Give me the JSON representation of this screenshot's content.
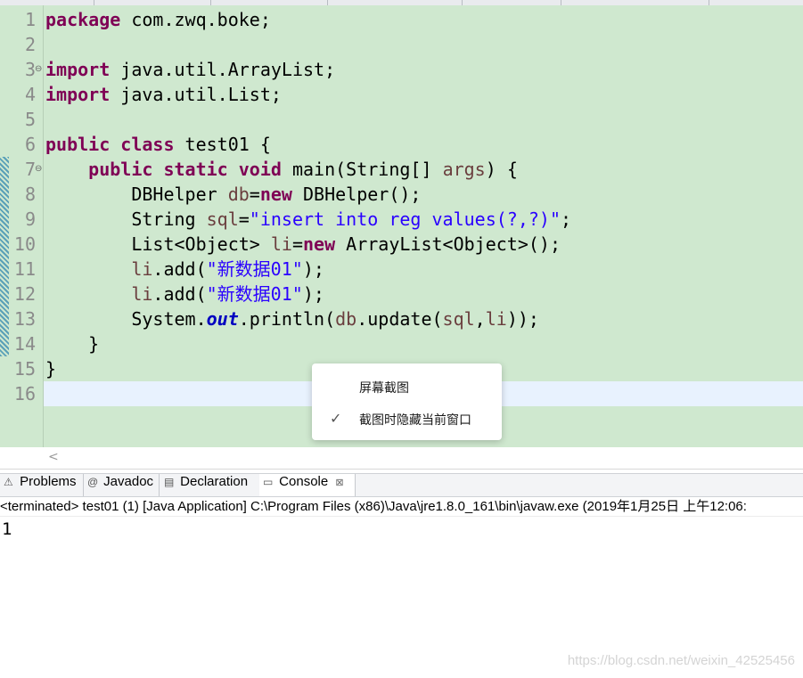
{
  "editor": {
    "line_numbers": [
      "1",
      "2",
      "3",
      "4",
      "5",
      "6",
      "7",
      "8",
      "9",
      "10",
      "11",
      "12",
      "13",
      "14",
      "15",
      "16"
    ],
    "fold_markers": [
      "⊖",
      "⊖"
    ]
  },
  "code": {
    "l1": {
      "kw": "package",
      "rest": " com.zwq.boke;"
    },
    "l3": {
      "kw": "import",
      "rest": " java.util.ArrayList;"
    },
    "l4": {
      "kw": "import",
      "rest": " java.util.List;"
    },
    "l6": {
      "kw1": "public",
      "kw2": "class",
      "rest": " test01 {"
    },
    "l7": {
      "indent": "    ",
      "kw1": "public",
      "kw2": "static",
      "kw3": "void",
      "rest1": " main(String[] ",
      "var": "args",
      "rest2": ") {"
    },
    "l8": {
      "indent": "        ",
      "t1": "DBHelper ",
      "var": "db",
      "t2": "=",
      "kw": "new",
      "t3": " DBHelper();"
    },
    "l9": {
      "indent": "        ",
      "t1": "String ",
      "var": "sql",
      "t2": "=",
      "str": "\"insert into reg values(?,?)\"",
      "t3": ";"
    },
    "l10": {
      "indent": "        ",
      "t1": "List<Object> ",
      "var": "li",
      "t2": "=",
      "kw": "new",
      "t3": " ArrayList<Object>();"
    },
    "l11": {
      "indent": "        ",
      "var": "li",
      "t1": ".add(",
      "str": "\"新数据01\"",
      "t2": ");"
    },
    "l12": {
      "indent": "        ",
      "var": "li",
      "t1": ".add(",
      "str": "\"新数据01\"",
      "t2": ");"
    },
    "l13": {
      "indent": "        ",
      "t1": "System.",
      "field": "out",
      "t2": ".println(",
      "var1": "db",
      "t3": ".update(",
      "var2": "sql",
      "t4": ",",
      "var3": "li",
      "t5": "));"
    },
    "l14": {
      "text": "    }"
    },
    "l15": {
      "text": "}"
    }
  },
  "context_menu": {
    "items": [
      {
        "label": "屏幕截图",
        "checked": false
      },
      {
        "label": "截图时隐藏当前窗口",
        "checked": true
      }
    ]
  },
  "scroll": {
    "left_arrow": "<"
  },
  "tabs": [
    {
      "label": "Problems",
      "icon": "problems-icon",
      "glyph": "⚠"
    },
    {
      "label": "Javadoc",
      "icon": "javadoc-icon",
      "glyph": "@"
    },
    {
      "label": "Declaration",
      "icon": "declaration-icon",
      "glyph": "▤"
    },
    {
      "label": "Console",
      "icon": "console-icon",
      "glyph": "▭",
      "close": "⊠"
    }
  ],
  "console": {
    "status": "<terminated> test01 (1) [Java Application] C:\\Program Files (x86)\\Java\\jre1.8.0_161\\bin\\javaw.exe (2019年1月25日 上午12:06:",
    "output": "1"
  },
  "watermark": "https://blog.csdn.net/weixin_42525456",
  "colors": {
    "editor_bg": "#cfe8cf",
    "keyword": "#7f0055",
    "string": "#2a00ff",
    "variable": "#6a3e3e",
    "field": "#0000c0",
    "current_line": "#e8f2fe"
  }
}
